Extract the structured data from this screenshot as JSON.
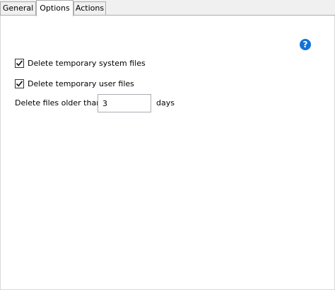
{
  "tabs": [
    {
      "label": "General",
      "active": false
    },
    {
      "label": "Options",
      "active": true
    },
    {
      "label": "Actions",
      "active": false
    }
  ],
  "help": {
    "icon": "help-icon",
    "glyph": "?",
    "color": "#1273d6"
  },
  "options": {
    "delete_system_files": {
      "label": "Delete temporary system files",
      "checked": true
    },
    "delete_user_files": {
      "label": "Delete temporary user files",
      "checked": true
    },
    "age": {
      "label": "Delete files older than",
      "value": "3",
      "unit": "days"
    }
  }
}
